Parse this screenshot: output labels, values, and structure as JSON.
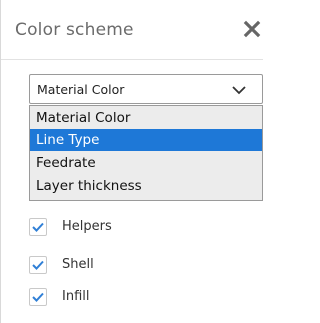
{
  "panel": {
    "title": "Color scheme",
    "close_icon": "close-icon"
  },
  "color_scheme_select": {
    "value": "Material Color",
    "options": [
      "Material Color",
      "Line Type",
      "Feedrate",
      "Layer thickness"
    ],
    "highlighted": "Line Type"
  },
  "checkboxes": [
    {
      "label": "Helpers",
      "checked": true
    },
    {
      "label": "Shell",
      "checked": true
    },
    {
      "label": "Infill",
      "checked": true
    }
  ],
  "colors": {
    "accent": "#1e78d7",
    "check": "#2f7fd6",
    "title": "#6b6b6b"
  }
}
